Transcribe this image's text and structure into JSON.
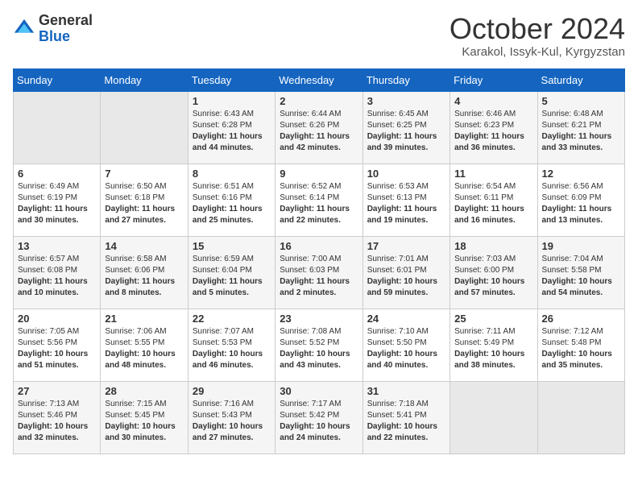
{
  "header": {
    "logo": {
      "general": "General",
      "blue": "Blue"
    },
    "title": "October 2024",
    "location": "Karakol, Issyk-Kul, Kyrgyzstan"
  },
  "days_of_week": [
    "Sunday",
    "Monday",
    "Tuesday",
    "Wednesday",
    "Thursday",
    "Friday",
    "Saturday"
  ],
  "weeks": [
    [
      {
        "day": "",
        "info": ""
      },
      {
        "day": "",
        "info": ""
      },
      {
        "day": "1",
        "info": "Sunrise: 6:43 AM\nSunset: 6:28 PM\nDaylight: 11 hours and 44 minutes."
      },
      {
        "day": "2",
        "info": "Sunrise: 6:44 AM\nSunset: 6:26 PM\nDaylight: 11 hours and 42 minutes."
      },
      {
        "day": "3",
        "info": "Sunrise: 6:45 AM\nSunset: 6:25 PM\nDaylight: 11 hours and 39 minutes."
      },
      {
        "day": "4",
        "info": "Sunrise: 6:46 AM\nSunset: 6:23 PM\nDaylight: 11 hours and 36 minutes."
      },
      {
        "day": "5",
        "info": "Sunrise: 6:48 AM\nSunset: 6:21 PM\nDaylight: 11 hours and 33 minutes."
      }
    ],
    [
      {
        "day": "6",
        "info": "Sunrise: 6:49 AM\nSunset: 6:19 PM\nDaylight: 11 hours and 30 minutes."
      },
      {
        "day": "7",
        "info": "Sunrise: 6:50 AM\nSunset: 6:18 PM\nDaylight: 11 hours and 27 minutes."
      },
      {
        "day": "8",
        "info": "Sunrise: 6:51 AM\nSunset: 6:16 PM\nDaylight: 11 hours and 25 minutes."
      },
      {
        "day": "9",
        "info": "Sunrise: 6:52 AM\nSunset: 6:14 PM\nDaylight: 11 hours and 22 minutes."
      },
      {
        "day": "10",
        "info": "Sunrise: 6:53 AM\nSunset: 6:13 PM\nDaylight: 11 hours and 19 minutes."
      },
      {
        "day": "11",
        "info": "Sunrise: 6:54 AM\nSunset: 6:11 PM\nDaylight: 11 hours and 16 minutes."
      },
      {
        "day": "12",
        "info": "Sunrise: 6:56 AM\nSunset: 6:09 PM\nDaylight: 11 hours and 13 minutes."
      }
    ],
    [
      {
        "day": "13",
        "info": "Sunrise: 6:57 AM\nSunset: 6:08 PM\nDaylight: 11 hours and 10 minutes."
      },
      {
        "day": "14",
        "info": "Sunrise: 6:58 AM\nSunset: 6:06 PM\nDaylight: 11 hours and 8 minutes."
      },
      {
        "day": "15",
        "info": "Sunrise: 6:59 AM\nSunset: 6:04 PM\nDaylight: 11 hours and 5 minutes."
      },
      {
        "day": "16",
        "info": "Sunrise: 7:00 AM\nSunset: 6:03 PM\nDaylight: 11 hours and 2 minutes."
      },
      {
        "day": "17",
        "info": "Sunrise: 7:01 AM\nSunset: 6:01 PM\nDaylight: 10 hours and 59 minutes."
      },
      {
        "day": "18",
        "info": "Sunrise: 7:03 AM\nSunset: 6:00 PM\nDaylight: 10 hours and 57 minutes."
      },
      {
        "day": "19",
        "info": "Sunrise: 7:04 AM\nSunset: 5:58 PM\nDaylight: 10 hours and 54 minutes."
      }
    ],
    [
      {
        "day": "20",
        "info": "Sunrise: 7:05 AM\nSunset: 5:56 PM\nDaylight: 10 hours and 51 minutes."
      },
      {
        "day": "21",
        "info": "Sunrise: 7:06 AM\nSunset: 5:55 PM\nDaylight: 10 hours and 48 minutes."
      },
      {
        "day": "22",
        "info": "Sunrise: 7:07 AM\nSunset: 5:53 PM\nDaylight: 10 hours and 46 minutes."
      },
      {
        "day": "23",
        "info": "Sunrise: 7:08 AM\nSunset: 5:52 PM\nDaylight: 10 hours and 43 minutes."
      },
      {
        "day": "24",
        "info": "Sunrise: 7:10 AM\nSunset: 5:50 PM\nDaylight: 10 hours and 40 minutes."
      },
      {
        "day": "25",
        "info": "Sunrise: 7:11 AM\nSunset: 5:49 PM\nDaylight: 10 hours and 38 minutes."
      },
      {
        "day": "26",
        "info": "Sunrise: 7:12 AM\nSunset: 5:48 PM\nDaylight: 10 hours and 35 minutes."
      }
    ],
    [
      {
        "day": "27",
        "info": "Sunrise: 7:13 AM\nSunset: 5:46 PM\nDaylight: 10 hours and 32 minutes."
      },
      {
        "day": "28",
        "info": "Sunrise: 7:15 AM\nSunset: 5:45 PM\nDaylight: 10 hours and 30 minutes."
      },
      {
        "day": "29",
        "info": "Sunrise: 7:16 AM\nSunset: 5:43 PM\nDaylight: 10 hours and 27 minutes."
      },
      {
        "day": "30",
        "info": "Sunrise: 7:17 AM\nSunset: 5:42 PM\nDaylight: 10 hours and 24 minutes."
      },
      {
        "day": "31",
        "info": "Sunrise: 7:18 AM\nSunset: 5:41 PM\nDaylight: 10 hours and 22 minutes."
      },
      {
        "day": "",
        "info": ""
      },
      {
        "day": "",
        "info": ""
      }
    ]
  ]
}
